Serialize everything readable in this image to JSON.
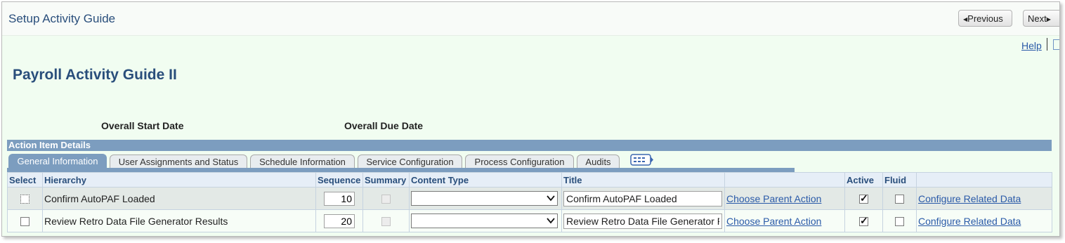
{
  "app": {
    "title": "Setup Activity Guide"
  },
  "nav": {
    "previous_label": "Previous",
    "next_label": "Next"
  },
  "help": {
    "label": "Help"
  },
  "page": {
    "title": "Payroll Activity Guide II",
    "overall_start_date_label": "Overall Start Date",
    "overall_due_date_label": "Overall Due Date"
  },
  "grid": {
    "header": "Action Item Details",
    "tabs": [
      {
        "label": "General Information",
        "active": true
      },
      {
        "label": "User Assignments and Status",
        "active": false
      },
      {
        "label": "Schedule Information",
        "active": false
      },
      {
        "label": "Service Configuration",
        "active": false
      },
      {
        "label": "Process Configuration",
        "active": false
      },
      {
        "label": "Audits",
        "active": false
      }
    ],
    "columns": {
      "select": "Select",
      "hierarchy": "Hierarchy",
      "sequence": "Sequence",
      "summary": "Summary",
      "content_type": "Content Type",
      "title": "Title",
      "parent": "",
      "active": "Active",
      "fluid": "Fluid",
      "related": ""
    },
    "rows": [
      {
        "select": false,
        "hierarchy": "Confirm AutoPAF Loaded",
        "sequence": "10",
        "summary": false,
        "content_type": "",
        "title": "Confirm AutoPAF Loaded",
        "parent_link": "Choose Parent Action",
        "active": true,
        "fluid": false,
        "related_link": "Configure Related Data"
      },
      {
        "select": false,
        "hierarchy": "Review Retro Data File Generator Results",
        "sequence": "20",
        "summary": false,
        "content_type": "",
        "title": "Review Retro Data File Generator Results",
        "parent_link": "Choose Parent Action",
        "active": true,
        "fluid": false,
        "related_link": "Configure Related Data"
      }
    ]
  },
  "icons": {
    "previous": "triangle-left-icon",
    "next": "triangle-right-icon",
    "show_all_columns": "show-all-columns-icon",
    "dropdown": "chevron-down-icon"
  }
}
